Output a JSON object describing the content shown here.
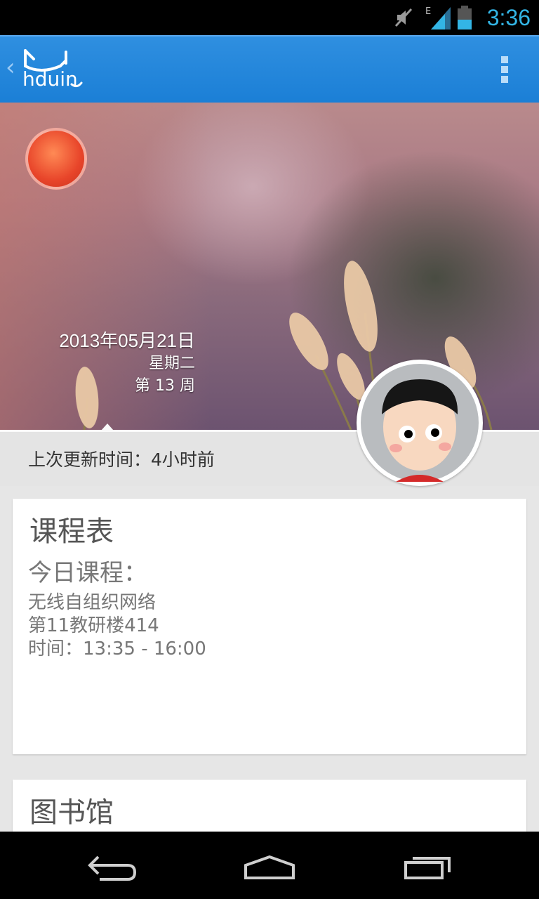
{
  "status_bar": {
    "time": "3:36",
    "network_type": "E"
  },
  "action_bar": {
    "logo_text": "hduin"
  },
  "hero": {
    "date": "2013年05月21日",
    "weekday": "星期二",
    "week": "第 13 周",
    "last_update": "上次更新时间：4小时前"
  },
  "schedule_card": {
    "title": "课程表",
    "today_label": "今日课程：",
    "course_name": "无线自组织网络",
    "location": "第11教研楼414",
    "time": "时间：13:35 - 16:00"
  },
  "library_card": {
    "title": "图书馆"
  },
  "colors": {
    "accent": "#33b5e5",
    "action_bar": "#1b7fd6"
  }
}
